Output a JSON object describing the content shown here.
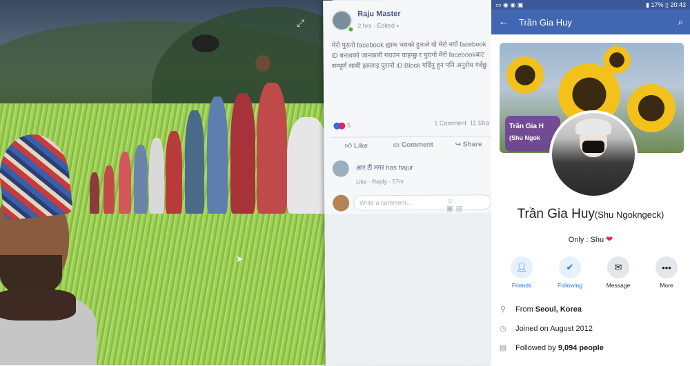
{
  "post": {
    "author": "Raju Master",
    "time": "2 hrs",
    "edited": "Edited",
    "text": "मेरो पुरानो facebook ह्याक भयको हुनाले यो मेरो नयाँ facebook iD बनायको जानकारी गराउन चाहन्छु र पुरानो मेरो facebookबाट सम्पूर्ण साथी हरुलाइ पुरानो iD Block गर्दिनु हुन पनि अनुरोध गर्दछु",
    "reaction_count": "5",
    "comment_count": "1 Comment",
    "share_count": "11 Sha",
    "like_label": "Like",
    "comment_label": "Comment",
    "share_label": "Share",
    "comment": {
      "author": "आर टी मगर",
      "text": "has hajur",
      "like": "Like",
      "reply": "Reply",
      "time": "57m"
    },
    "write_placeholder": "Write a comment..."
  },
  "phone": {
    "status_time": "20:43",
    "battery": "17%",
    "header_title": "Trần Gia Huy",
    "cover_badge_line1": "Trần Gia H",
    "cover_badge_line2": "(Shu Ngok",
    "name": "Trần Gia Huy",
    "alt_name": "(Shu Ngokngeck)",
    "bio_text": "Only : Shu",
    "buttons": {
      "friends": "Friends",
      "following": "Following",
      "message": "Message",
      "more": "More"
    },
    "info": {
      "from_prefix": "From",
      "from_value": "Seoul, Korea",
      "joined": "Joined on August 2012",
      "followed_prefix": "Followed by",
      "followed_value": "9,094 people"
    },
    "colors": {
      "brand": "#4267b2",
      "accent_blue": "#1877f2",
      "heart": "#e0245e"
    }
  }
}
